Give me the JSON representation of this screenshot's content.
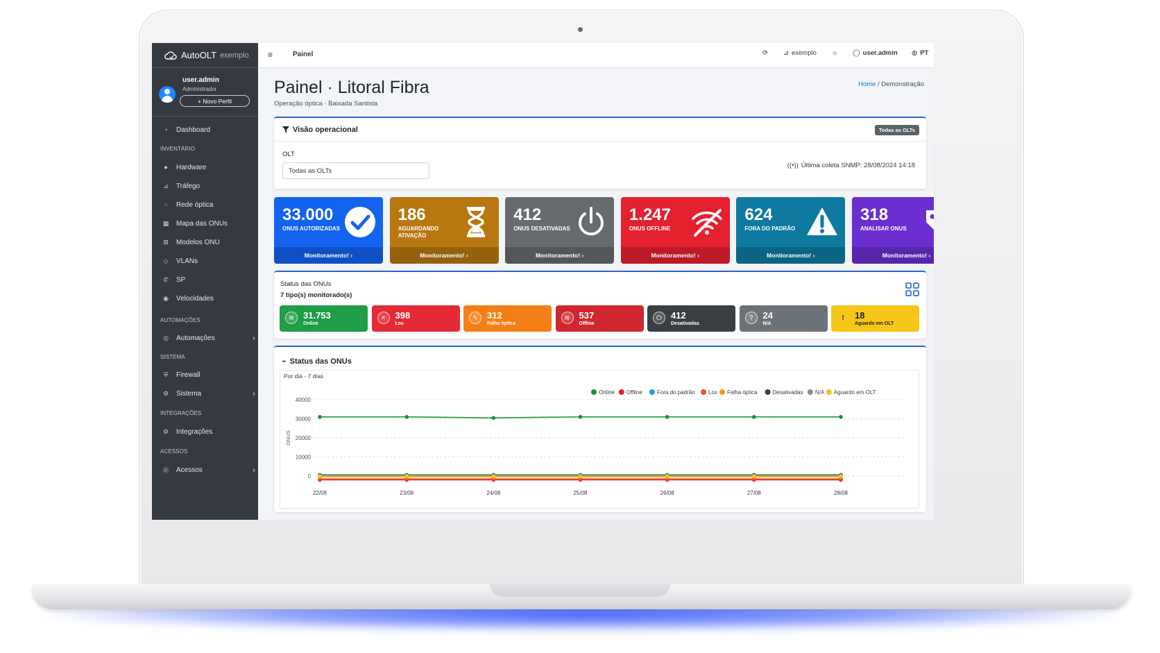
{
  "brand": {
    "name": "AutoOLT",
    "sub": "exemplo"
  },
  "user": {
    "name": "user.admin",
    "role": "Administrador",
    "new_profile": "+ Novo Perfil"
  },
  "nav": {
    "dashboard": "Dashboard",
    "hdr_inventario": "INVENTÁRIO",
    "hardware": "Hardware",
    "trafego": "Tráfego",
    "rede": "Rede óptica",
    "mapa": "Mapa das ONUs",
    "modelos": "Modelos ONU",
    "vlans": "VLANs",
    "sp": "SP",
    "velocidades": "Velocidades",
    "hdr_automacoes": "AUTOMAÇÕES",
    "automacoes": "Automações",
    "hdr_sistema": "SISTEMA",
    "firewall": "Firewall",
    "sistema": "Sistema",
    "hdr_integracoes": "INTEGRAÇÕES",
    "integracoes": "Integrações",
    "hdr_acessos": "ACESSOS",
    "acessos": "Acessos"
  },
  "topbar": {
    "crumb": "Painel",
    "tenant": "exemplo",
    "user": "user.admin",
    "lang": "PT"
  },
  "page": {
    "title": "Painel · Litoral Fibra",
    "subtitle": "Operação óptica · Baixada Santista",
    "bc_home": "Home",
    "bc_sep": "/",
    "bc_current": "Demonstração"
  },
  "vision": {
    "title": "Visão operacional",
    "badge": "Todas as OLTs",
    "olt_label": "OLT",
    "olt_value": "Todas as OLTs",
    "snmp": "Última coleta SNMP: 28/08/2024 14:18"
  },
  "kpis": [
    {
      "value": "33.000",
      "label": "ONUS AUTORIZADAS",
      "footer": "Monitoramento! ›",
      "color": "#1363f0",
      "icon": "check-circle-icon"
    },
    {
      "value": "186",
      "label": "AGUARDANDO ATIVAÇÃO",
      "footer": "Monitoramento! ›",
      "color": "#b8770f",
      "icon": "hourglass-icon"
    },
    {
      "value": "412",
      "label": "ONUS DESATIVADAS",
      "footer": "Monitoramento! ›",
      "color": "#666b70",
      "icon": "power-icon"
    },
    {
      "value": "1.247",
      "label": "ONUS OFFLINE",
      "footer": "Monitoramento! ›",
      "color": "#e5202f",
      "icon": "wifi-off-icon"
    },
    {
      "value": "624",
      "label": "FORA DO PADRÃO",
      "footer": "Monitoramento! ›",
      "color": "#0e7aa0",
      "icon": "warning-icon"
    },
    {
      "value": "318",
      "label": "ANALISAR ONUS",
      "footer": "Monitoramento! ›",
      "color": "#6b2fd1",
      "icon": "tag-icon"
    }
  ],
  "status": {
    "title": "Status das ONUs",
    "count": "7 tipo(s) monitorado(s)",
    "pills": [
      {
        "value": "31.753",
        "label": "Online",
        "color": "#1f9d47",
        "icon": "wifi-icon"
      },
      {
        "value": "398",
        "label": "Los",
        "color": "#e42a35",
        "icon": "x-circle-icon"
      },
      {
        "value": "312",
        "label": "Falha óptica",
        "color": "#f57f17",
        "icon": "bolt-icon"
      },
      {
        "value": "537",
        "label": "Offline",
        "color": "#d02630",
        "icon": "wifi-icon"
      },
      {
        "value": "412",
        "label": "Desativadas",
        "color": "#3a3f44",
        "icon": "power-icon"
      },
      {
        "value": "24",
        "label": "N/A",
        "color": "#6c7378",
        "icon": "question-icon"
      },
      {
        "value": "18",
        "label": "Aguardo em OLT",
        "color": "#f5c518",
        "icon": "exclamation-icon"
      }
    ]
  },
  "chart": {
    "title": "Status das ONUs",
    "period": "Por dia - 7 dias"
  },
  "chart_data": {
    "type": "line",
    "x": [
      "22/08",
      "23/08",
      "24/08",
      "25/08",
      "26/08",
      "27/08",
      "28/08"
    ],
    "ylabel": "ONUS",
    "ylim": [
      0,
      40000
    ],
    "yticks": [
      0,
      10000,
      20000,
      30000,
      40000
    ],
    "grid": true,
    "legend_position": "top-right",
    "series": [
      {
        "name": "Online",
        "color": "#1a8f3a",
        "values": [
          31000,
          31000,
          30500,
          31000,
          31000,
          31000,
          31000
        ]
      },
      {
        "name": "Offline",
        "color": "#e5202f",
        "values": [
          -2000,
          -2000,
          -2000,
          -2000,
          -2000,
          -2000,
          -2000
        ]
      },
      {
        "name": "Fora do padrão",
        "color": "#1ea0e0",
        "values": [
          600,
          600,
          600,
          600,
          600,
          600,
          600
        ]
      },
      {
        "name": "Los",
        "color": "#f0501e",
        "values": [
          -1500,
          -1500,
          -1500,
          -1500,
          -1500,
          -1500,
          -1500
        ]
      },
      {
        "name": "Falha óptica",
        "color": "#f39c12",
        "values": [
          -400,
          -400,
          -400,
          -400,
          -400,
          -400,
          -400
        ]
      },
      {
        "name": "Desativadas",
        "color": "#3a3f44",
        "values": [
          400,
          400,
          400,
          400,
          400,
          400,
          400
        ]
      },
      {
        "name": "N/A",
        "color": "#8a9096",
        "values": [
          24,
          24,
          24,
          24,
          24,
          24,
          24
        ]
      },
      {
        "name": "Aguardo em OLT",
        "color": "#f5c518",
        "values": [
          18,
          18,
          18,
          18,
          18,
          18,
          18
        ]
      }
    ]
  }
}
